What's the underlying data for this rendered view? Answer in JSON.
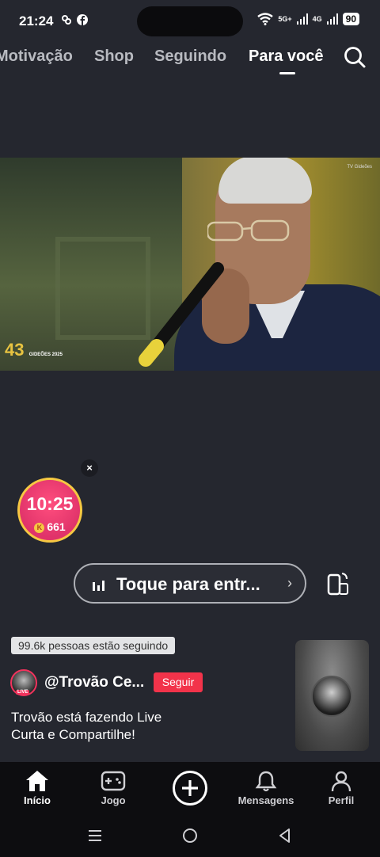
{
  "status_bar": {
    "time": "21:24",
    "network_label_1": "5G+",
    "network_label_2": "4G",
    "battery": "90"
  },
  "top_tabs": [
    {
      "label": "Motivação"
    },
    {
      "label": "Shop"
    },
    {
      "label": "Seguindo"
    },
    {
      "label": "Para você",
      "active": true
    }
  ],
  "live": {
    "timer": "10:25",
    "coins": "661",
    "close_symbol": "×",
    "enter_label": "Toque para entr...",
    "followers_badge": "99.6k pessoas estão seguindo",
    "username": "@Trovão Ce...",
    "follow_label": "Seguir",
    "avatar_live_tag": "LIVE",
    "description_line1": "Trovão está fazendo Live",
    "description_line2": "Curta e Compartilhe!",
    "video_watermark": "TV Gideões",
    "video_logo_text": "43",
    "video_logo_sub": "GIDEÕES 2025"
  },
  "bottom_nav": [
    {
      "label": "Início",
      "icon": "home-icon",
      "active": true
    },
    {
      "label": "Jogo",
      "icon": "gamepad-icon"
    },
    {
      "label": "",
      "icon": "plus-icon"
    },
    {
      "label": "Mensagens",
      "icon": "bell-icon"
    },
    {
      "label": "Perfil",
      "icon": "person-icon"
    }
  ],
  "colors": {
    "accent": "#f2334a",
    "background": "#25272f",
    "nav": "#0d0d10",
    "timer_bg": "#e0336a",
    "timer_ring": "#f6c842"
  }
}
